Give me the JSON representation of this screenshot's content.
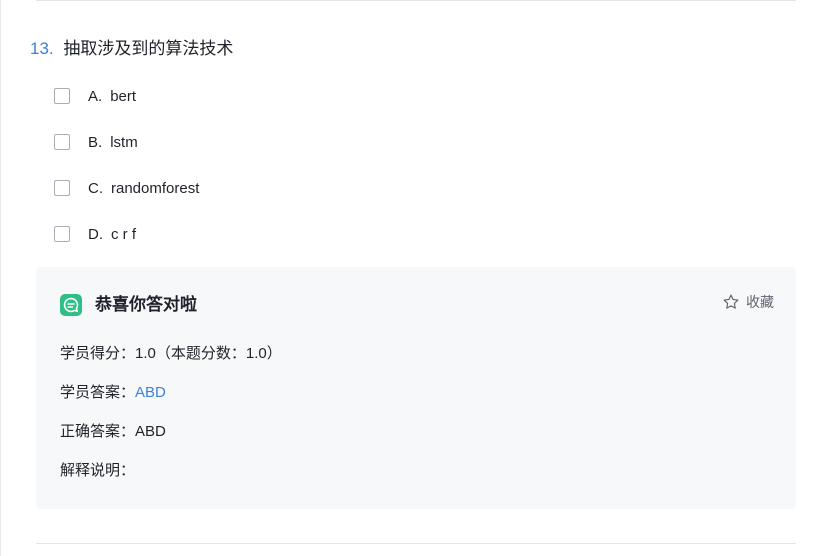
{
  "question": {
    "number": "13.",
    "text": "抽取涉及到的算法技术",
    "options": [
      {
        "letter": "A.",
        "text": "bert"
      },
      {
        "letter": "B.",
        "text": "lstm"
      },
      {
        "letter": "C.",
        "text": "randomforest"
      },
      {
        "letter": "D.",
        "text": "c r f"
      }
    ]
  },
  "result": {
    "title": "恭喜你答对啦",
    "favorite_label": "收藏",
    "score_label": "学员得分：",
    "score_value": "1.0（本题分数：1.0）",
    "student_answer_label": "学员答案：",
    "student_answer_value": "ABD",
    "correct_answer_label": "正确答案：",
    "correct_answer_value": "ABD",
    "explanation_label": "解释说明：",
    "explanation_value": ""
  },
  "colors": {
    "accent": "#3b82d8",
    "success": "#2dbf86",
    "panel_background": "#f7f8fa"
  },
  "icons": {
    "result": "chat-bubble-icon",
    "favorite": "star-icon"
  }
}
